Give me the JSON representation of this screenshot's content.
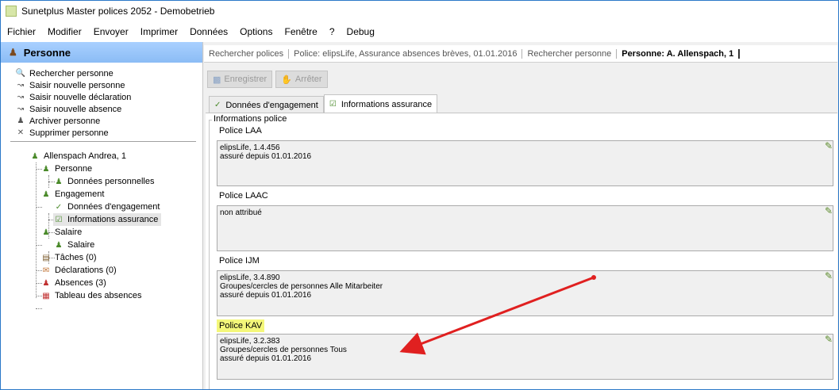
{
  "window": {
    "title": "Sunetplus Master polices 2052 - Demobetrieb"
  },
  "menu": [
    "Fichier",
    "Modifier",
    "Envoyer",
    "Imprimer",
    "Données",
    "Options",
    "Fenêtre",
    "?",
    "Debug"
  ],
  "left": {
    "header": "Personne",
    "actions": [
      {
        "label": "Rechercher personne",
        "icon": "search-icon"
      },
      {
        "label": "Saisir nouvelle personne",
        "icon": "wand-icon"
      },
      {
        "label": "Saisir nouvelle déclaration",
        "icon": "wand-icon"
      },
      {
        "label": "Saisir nouvelle absence",
        "icon": "wand-icon"
      },
      {
        "label": "Archiver personne",
        "icon": "person-icon"
      },
      {
        "label": "Supprimer personne",
        "icon": "delete-icon"
      }
    ],
    "tree": {
      "root": "Allenspach Andrea, 1",
      "personne": "Personne",
      "donnees_personnelles": "Données personnelles",
      "engagement": "Engagement",
      "donnees_engagement": "Données d'engagement",
      "informations_assurance": "Informations assurance",
      "salaire": "Salaire",
      "salaire_child": "Salaire",
      "taches": "Tâches (0)",
      "declarations": "Déclarations (0)",
      "absences": "Absences (3)",
      "tableau": "Tableau des absences"
    }
  },
  "breadcrumb": [
    "Rechercher polices",
    "Police: elipsLife, Assurance absences brèves, 01.01.2016",
    "Rechercher personne",
    "Personne: A. Allenspach, 1"
  ],
  "toolbar": {
    "save": "Enregistrer",
    "stop": "Arrêter"
  },
  "tabs": [
    "Données d'engagement",
    "Informations assurance"
  ],
  "group_title": "Informations police",
  "policies": [
    {
      "label": "Police LAA",
      "lines": [
        "elipsLife, 1.4.456",
        "assuré depuis 01.01.2016"
      ]
    },
    {
      "label": "Police LAAC",
      "lines": [
        "non attribué"
      ]
    },
    {
      "label": "Police IJM",
      "lines": [
        "elipsLife, 3.4.890",
        "Groupes/cercles de personnes Alle Mitarbeiter",
        "assuré depuis 01.01.2016"
      ]
    },
    {
      "label": "Police KAV",
      "lines": [
        "elipsLife, 3.2.383",
        "Groupes/cercles de personnes Tous",
        "assuré depuis 01.01.2016"
      ]
    }
  ],
  "colors": {
    "highlight": "#f4f77a",
    "arrow": "#e02020",
    "header": "#a9d0ff"
  }
}
